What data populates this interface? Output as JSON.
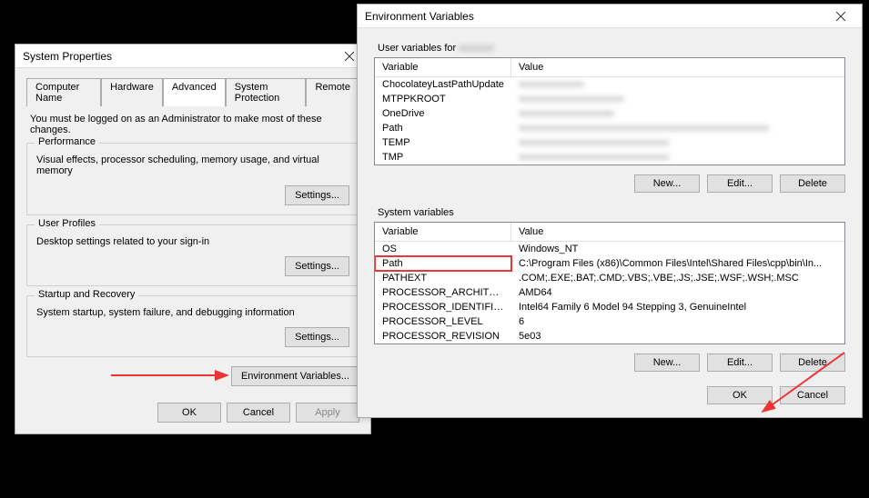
{
  "sp": {
    "title": "System Properties",
    "tabs": [
      "Computer Name",
      "Hardware",
      "Advanced",
      "System Protection",
      "Remote"
    ],
    "active_tab": 2,
    "note": "You must be logged on as an Administrator to make most of these changes.",
    "groups": {
      "perf": {
        "legend": "Performance",
        "desc": "Visual effects, processor scheduling, memory usage, and virtual memory",
        "btn": "Settings..."
      },
      "profiles": {
        "legend": "User Profiles",
        "desc": "Desktop settings related to your sign-in",
        "btn": "Settings..."
      },
      "startup": {
        "legend": "Startup and Recovery",
        "desc": "System startup, system failure, and debugging information",
        "btn": "Settings..."
      }
    },
    "env_btn": "Environment Variables...",
    "ok": "OK",
    "cancel": "Cancel",
    "apply": "Apply"
  },
  "env": {
    "title": "Environment Variables",
    "user_section": "User variables for",
    "user_blurred": "xxxxxxx",
    "sys_section": "System variables",
    "headers": {
      "var": "Variable",
      "val": "Value"
    },
    "user_vars": [
      {
        "var": "ChocolateyLastPathUpdate",
        "val": "xxxxxxxxxxxxx",
        "blur": true
      },
      {
        "var": "MTPPKROOT",
        "val": "xxxxxxxxxxxxxxxxxxxxx",
        "blur": true
      },
      {
        "var": "OneDrive",
        "val": "xxxxxxxxxxxxxxxxxxx",
        "blur": true
      },
      {
        "var": "Path",
        "val": "xxxxxxxxxxxxxxxxxxxxxxxxxxxxxxxxxxxxxxxxxxxxxxxxxx",
        "blur": true
      },
      {
        "var": "TEMP",
        "val": "xxxxxxxxxxxxxxxxxxxxxxxxxxxxxx",
        "blur": true
      },
      {
        "var": "TMP",
        "val": "xxxxxxxxxxxxxxxxxxxxxxxxxxxxxx",
        "blur": true
      }
    ],
    "sys_vars": [
      {
        "var": "OS",
        "val": "Windows_NT"
      },
      {
        "var": "Path",
        "val": "C:\\Program Files (x86)\\Common Files\\Intel\\Shared Files\\cpp\\bin\\In...",
        "hl": true
      },
      {
        "var": "PATHEXT",
        "val": ".COM;.EXE;.BAT;.CMD;.VBS;.VBE;.JS;.JSE;.WSF;.WSH;.MSC"
      },
      {
        "var": "PROCESSOR_ARCHITECTURE",
        "val": "AMD64"
      },
      {
        "var": "PROCESSOR_IDENTIFIER",
        "val": "Intel64 Family 6 Model 94 Stepping 3, GenuineIntel"
      },
      {
        "var": "PROCESSOR_LEVEL",
        "val": "6"
      },
      {
        "var": "PROCESSOR_REVISION",
        "val": "5e03"
      }
    ],
    "new": "New...",
    "edit": "Edit...",
    "delete": "Delete",
    "ok": "OK",
    "cancel": "Cancel"
  }
}
